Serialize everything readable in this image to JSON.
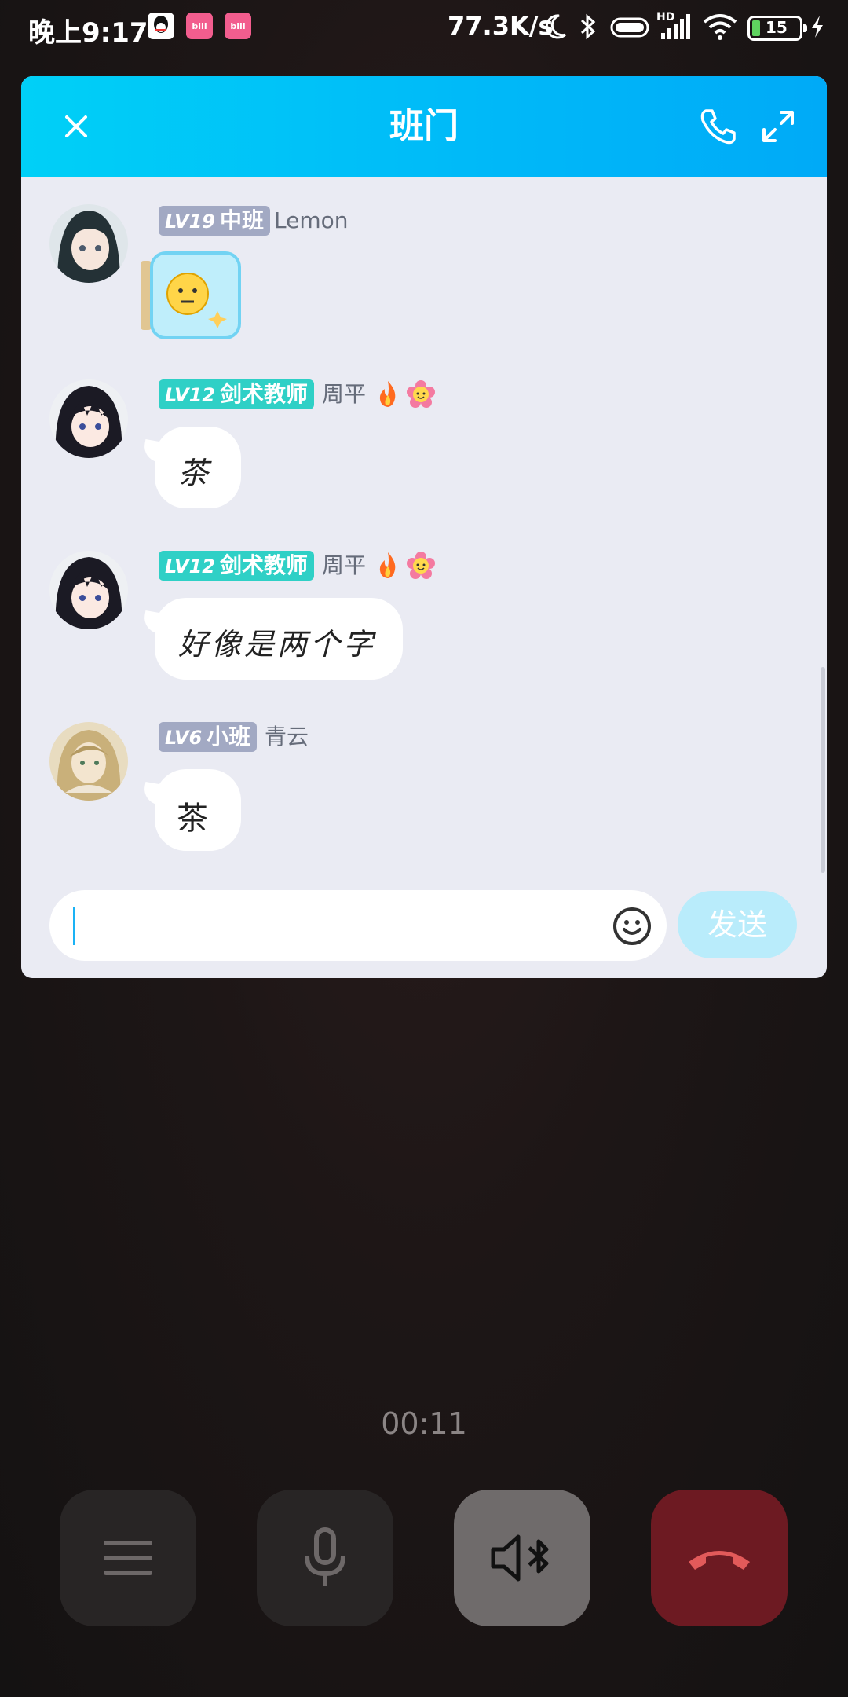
{
  "status_bar": {
    "time": "晚上9:17",
    "net_speed": "77.3K/s",
    "hd_label": "HD",
    "battery_level": "15",
    "app_icons": [
      "qq-icon",
      "bilibili-icon",
      "bilibili-icon"
    ]
  },
  "header": {
    "title": "班门",
    "close_icon": "close-icon",
    "phone_icon": "phone-icon",
    "expand_icon": "expand-icon"
  },
  "messages": [
    {
      "level": "LV19",
      "rank": "中班",
      "name": "Lemon",
      "type": "sticker",
      "badge_color": "#a2a9c3"
    },
    {
      "level": "LV12",
      "rank": "剑术教师",
      "name": "周平",
      "text": "茶",
      "type": "handwriting",
      "badge_color": "#2fd0c6",
      "decorations": [
        "fire-icon",
        "flower-face-icon"
      ]
    },
    {
      "level": "LV12",
      "rank": "剑术教师",
      "name": "周平",
      "text": "好像是两个字",
      "type": "handwriting",
      "badge_color": "#2fd0c6",
      "decorations": [
        "fire-icon",
        "flower-face-icon"
      ]
    },
    {
      "level": "LV6",
      "rank": "小班",
      "name": "青云",
      "text": "茶",
      "type": "text",
      "badge_color": "#a2a9c3"
    }
  ],
  "input": {
    "placeholder": "",
    "value": ""
  },
  "send_button": {
    "label": "发送"
  },
  "call": {
    "timer": "00:11",
    "controls": [
      "menu-icon",
      "microphone-icon",
      "speaker-bluetooth-icon",
      "hang-up-icon"
    ],
    "hangup_color": "#7a1a24"
  }
}
